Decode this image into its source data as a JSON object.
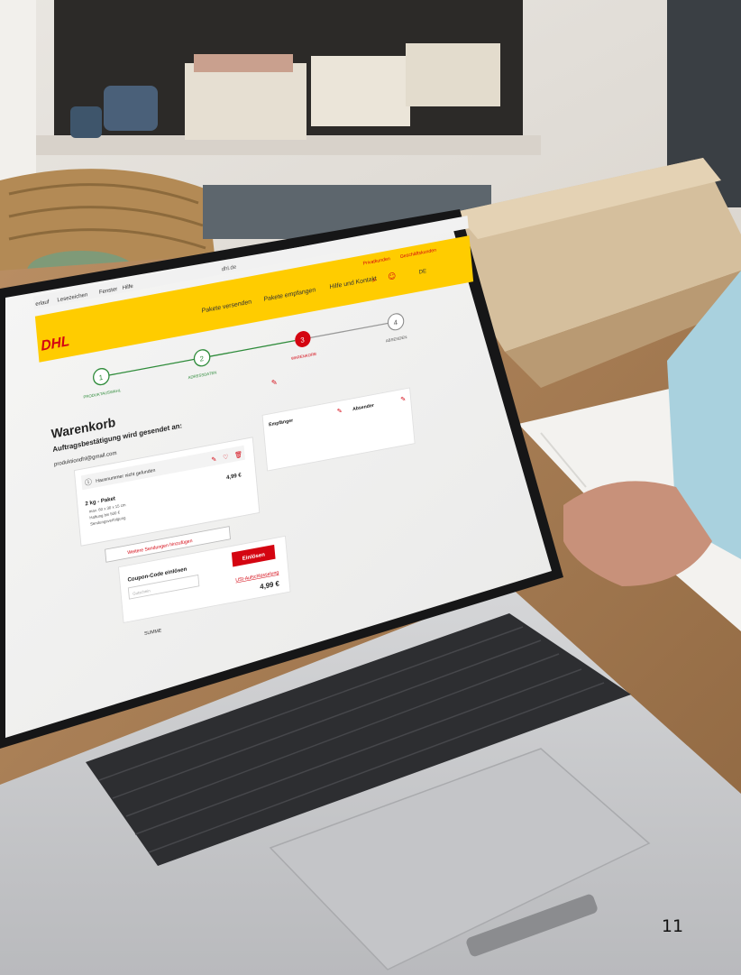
{
  "page": {
    "number": "11"
  },
  "browser": {
    "menu": [
      "erlauf",
      "Lesezeichen",
      "Fenster",
      "Hilfe"
    ],
    "address": "dhl.de"
  },
  "dhl": {
    "logo": "DHL",
    "nav": [
      "Pakete versenden",
      "Pakete empfangen",
      "Hilfe und Kontakt"
    ],
    "top_links": [
      "Privatkunden",
      "Geschäftskunden"
    ],
    "lang": "DE",
    "steps": [
      {
        "num": "1",
        "label": "PRODUKTAUSWAHL"
      },
      {
        "num": "2",
        "label": "ADRESSDATEN"
      },
      {
        "num": "3",
        "label": "WARENKORB"
      },
      {
        "num": "4",
        "label": "ABSENDEN"
      }
    ],
    "title": "Warenkorb",
    "confirm_heading": "Auftragsbestätigung wird gesendet an:",
    "email": "produktiondhl@gmail.com",
    "warning": "Hausnummer nicht gefunden",
    "package_name": "2 kg - Paket",
    "package_details": [
      "max. 60 x 30 x 15 cm",
      "Haftung bis 500 €",
      "Sendungsverfolgung"
    ],
    "package_price": "4,99 €",
    "recipient_label": "Empfänger",
    "sender_label": "Absender",
    "add_more": "Weitere Sendungen hinzufügen",
    "coupon_label": "Coupon-Code einlösen",
    "coupon_button": "Einlösen",
    "coupon_placeholder": "Gutschein",
    "vat_link": "USt-Aufschlüsselung",
    "total_price": "4,99 €",
    "sum_label": "SUMME"
  },
  "colors": {
    "dhl_yellow": "#FFCC00",
    "dhl_red": "#D40511",
    "step_green": "#2E8B3A"
  }
}
